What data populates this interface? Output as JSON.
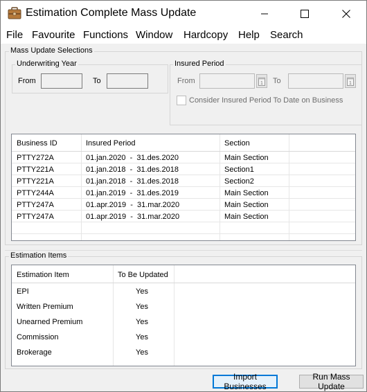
{
  "window": {
    "title": "Estimation Complete Mass Update",
    "minimize": "minimize",
    "maximize": "maximize",
    "close": "close"
  },
  "menu": [
    "File",
    "Favourite",
    "Functions",
    "Window",
    "Hardcopy",
    "Help",
    "Search"
  ],
  "mass_update": {
    "group_label": "Mass Update Selections",
    "underwriting_year": {
      "label": "Underwriting Year",
      "from_label": "From",
      "from_value": "",
      "to_label": "To",
      "to_value": ""
    },
    "insured_period": {
      "label": "Insured Period",
      "from_label": "From",
      "from_value": "",
      "to_label": "To",
      "to_value": "",
      "calendar_glyph": "1",
      "checkbox_label": "Consider Insured Period To Date on Business",
      "checkbox_checked": false
    }
  },
  "business_table": {
    "columns": [
      "Business ID",
      "Insured Period",
      "Section"
    ],
    "rows": [
      {
        "id": "PTTY272A",
        "period": "01.jan.2020  -  31.des.2020",
        "section": "Main Section"
      },
      {
        "id": "PTTY221A",
        "period": "01.jan.2018  -  31.des.2018",
        "section": "Section1"
      },
      {
        "id": "PTTY221A",
        "period": "01.jan.2018  -  31.des.2018",
        "section": "Section2"
      },
      {
        "id": "PTTY244A",
        "period": "01.jan.2019  -  31.des.2019",
        "section": "Main Section"
      },
      {
        "id": "PTTY247A",
        "period": "01.apr.2019  -  31.mar.2020",
        "section": "Main Section"
      },
      {
        "id": "PTTY247A",
        "period": "01.apr.2019  -  31.mar.2020",
        "section": "Main Section"
      }
    ]
  },
  "estimation_items": {
    "group_label": "Estimation Items",
    "columns": [
      "Estimation Item",
      "To Be Updated"
    ],
    "rows": [
      {
        "item": "EPI",
        "update": "Yes"
      },
      {
        "item": "Written Premium",
        "update": "Yes"
      },
      {
        "item": "Unearned Premium",
        "update": "Yes"
      },
      {
        "item": "Commission",
        "update": "Yes"
      },
      {
        "item": "Brokerage",
        "update": "Yes"
      }
    ]
  },
  "buttons": {
    "import": "Import Businesses",
    "run": "Run Mass Update"
  }
}
